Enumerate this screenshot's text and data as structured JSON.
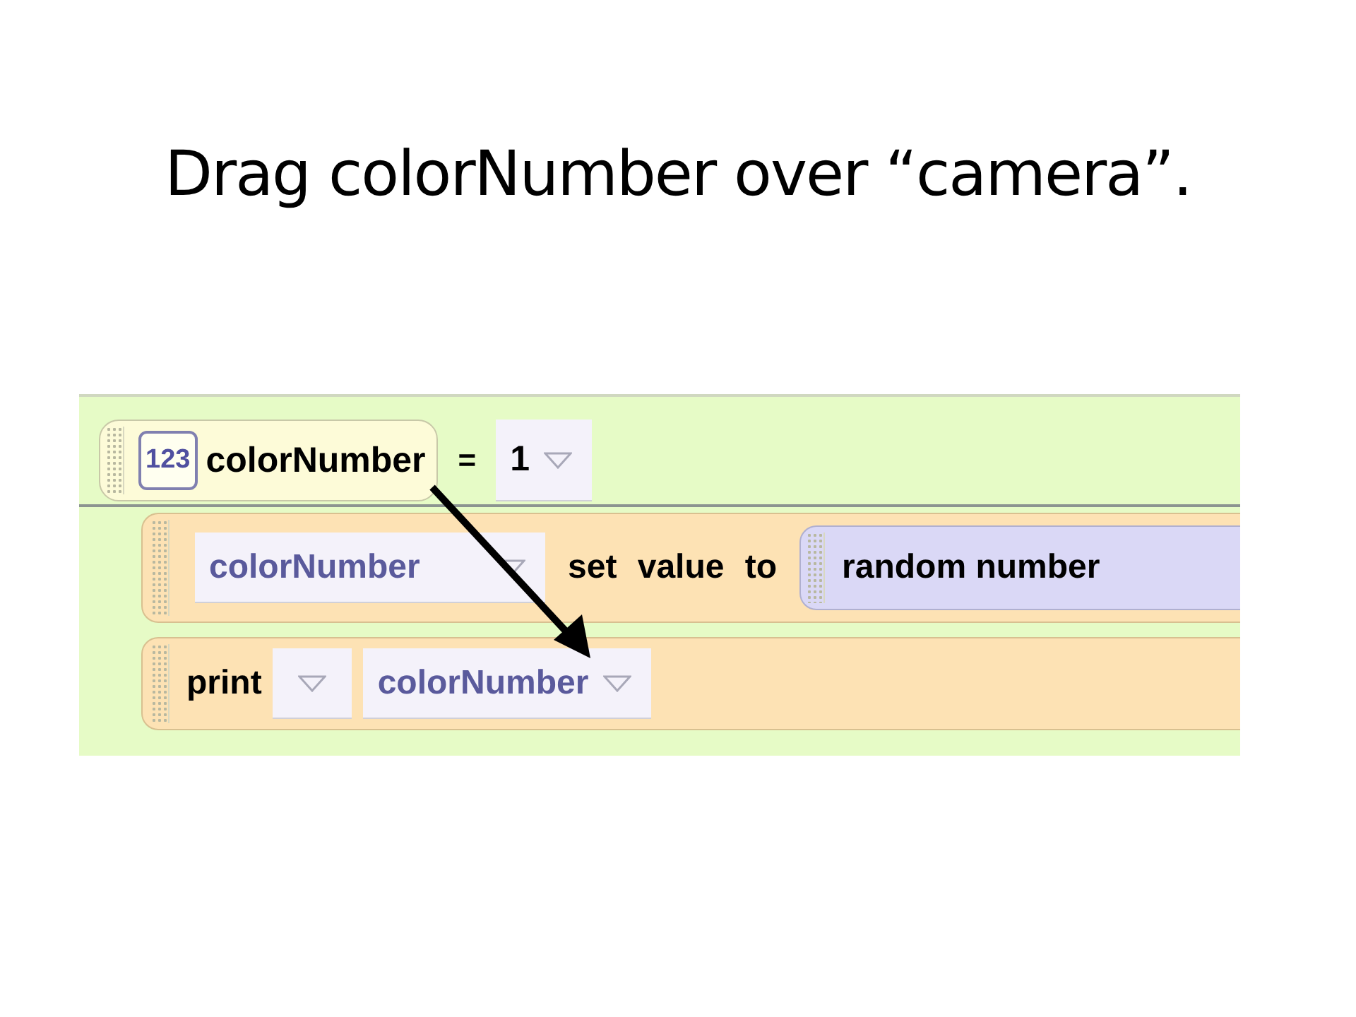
{
  "slide": {
    "title": "Drag colorNumber over “camera”."
  },
  "variable": {
    "icon": "123",
    "name": "colorNumber",
    "operator": "=",
    "value": "1"
  },
  "statements": [
    {
      "kind": "set",
      "target": "colorNumber",
      "verb": "set value to",
      "argument": "random number"
    },
    {
      "kind": "print",
      "label": "print",
      "argument": "colorNumber"
    }
  ]
}
